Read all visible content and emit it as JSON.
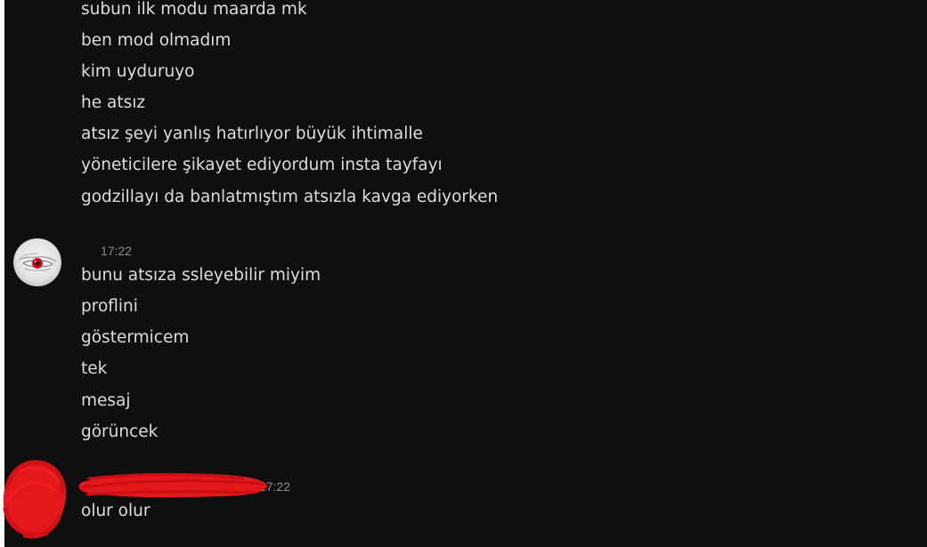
{
  "messages_group_1": [
    "subun ilk modu maarda mk",
    "ben mod olmadım",
    "kim uyduruyo",
    "he atsız",
    "atsız şeyi yanlış hatırlıyor büyük ihtimalle",
    "yöneticilere şikayet ediyordum insta tayfayı",
    "godzillayı da banlatmıştım atsızla kavga ediyorken"
  ],
  "message_group_2": {
    "timestamp": "17:22",
    "lines": [
      "bunu atsıza ssleyebilir miyim",
      "proflini",
      "göstermicem",
      "tek",
      "mesaj",
      "görüncek"
    ]
  },
  "message_group_3": {
    "timestamp": "17:22",
    "lines": [
      "olur olur"
    ]
  },
  "colors": {
    "background": "#0f0f10",
    "text": "#dbdee1",
    "timestamp": "#8b8e94",
    "redaction": "#e4171b"
  },
  "icons": {
    "avatar_1": "red-eye-avatar",
    "avatar_3": "redacted-avatar"
  }
}
